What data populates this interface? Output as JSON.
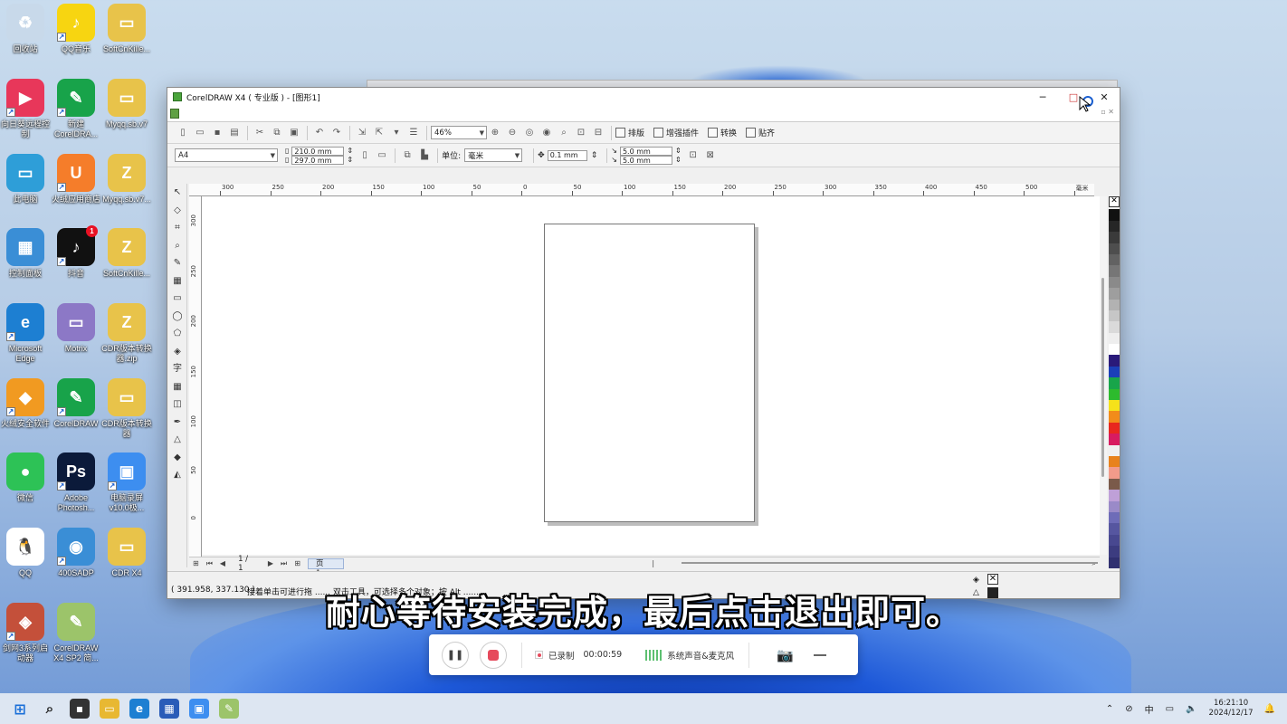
{
  "desktop_icons": [
    {
      "label": "回收站",
      "color": "#c8d9ea",
      "glyph": "♻",
      "link": false,
      "x": 0
    },
    {
      "label": "QQ音乐",
      "color": "#f7d511",
      "glyph": "♪",
      "link": true
    },
    {
      "label": "SoftCnKille...",
      "color": "#e8c34a",
      "glyph": "▭",
      "link": false
    },
    {
      "label": "向日葵远程控制",
      "color": "#e8375a",
      "glyph": "▶",
      "link": true
    },
    {
      "label": "新建 CorelDRA...",
      "color": "#18a34a",
      "glyph": "✎",
      "link": true
    },
    {
      "label": "Myqq.sb.v7",
      "color": "#e8c34a",
      "glyph": "▭",
      "link": false
    },
    {
      "label": "此电脑",
      "color": "#2e9ed8",
      "glyph": "▭",
      "link": false
    },
    {
      "label": "火绒应用商店",
      "color": "#f57d2a",
      "glyph": "U",
      "link": true
    },
    {
      "label": "Myqq.sb.v7...",
      "color": "#e8c34a",
      "glyph": "Z",
      "link": false
    },
    {
      "label": "控制面板",
      "color": "#3a8ed6",
      "glyph": "▦",
      "link": false
    },
    {
      "label": "抖音",
      "color": "#111111",
      "glyph": "♪",
      "link": true,
      "badge": "1"
    },
    {
      "label": "SoftCnKille...",
      "color": "#e8c34a",
      "glyph": "Z",
      "link": false
    },
    {
      "label": "Microsoft Edge",
      "color": "#1d7fd2",
      "glyph": "e",
      "link": true
    },
    {
      "label": "Motrix",
      "color": "#8c78c6",
      "glyph": "▭",
      "link": false
    },
    {
      "label": "CDR版本转换器.zip",
      "color": "#e8c34a",
      "glyph": "Z",
      "link": false
    },
    {
      "label": "火绒安全软件",
      "color": "#f19a21",
      "glyph": "◆",
      "link": true
    },
    {
      "label": "CorelDRAW",
      "color": "#18a34a",
      "glyph": "✎",
      "link": true
    },
    {
      "label": "CDR版本转换器",
      "color": "#e8c34a",
      "glyph": "▭",
      "link": false
    },
    {
      "label": "微信",
      "color": "#2dc256",
      "glyph": "●",
      "link": false
    },
    {
      "label": "Adobe Photosh...",
      "color": "#0b1a3a",
      "glyph": "Ps",
      "link": true
    },
    {
      "label": "电脑录屏 v10.0极...",
      "color": "#3d8ef0",
      "glyph": "▣",
      "link": true
    },
    {
      "label": "QQ",
      "color": "#ffffff",
      "glyph": "🐧",
      "link": false
    },
    {
      "label": "400SADP",
      "color": "#3a8ed6",
      "glyph": "◉",
      "link": true
    },
    {
      "label": "CDR X4",
      "color": "#e8c34a",
      "glyph": "▭",
      "link": false
    },
    {
      "label": "剑网3系列启动器",
      "color": "#c4503a",
      "glyph": "◈",
      "link": true
    },
    {
      "label": "CorelDRAW X4 SP2 简...",
      "color": "#9cc46a",
      "glyph": "✎",
      "link": false
    }
  ],
  "window": {
    "title": "CorelDRAW X4 ( 专业版 ) - [图形1]",
    "minimize": "─",
    "maximize": "□",
    "close": "✕"
  },
  "toolbar": {
    "zoom": "46%",
    "paste_layout": "排版",
    "plugins": "增强插件",
    "convert": "转换",
    "snap": "贴齐"
  },
  "propbar": {
    "page_size": "A4",
    "width": "210.0 mm",
    "height": "297.0 mm",
    "unit_label": "单位:",
    "unit": "毫米",
    "nudge": "0.1 mm",
    "dup_x": "5.0 mm",
    "dup_y": "5.0 mm"
  },
  "ruler": {
    "h_ticks": [
      "300",
      "250",
      "200",
      "150",
      "100",
      "50",
      "0",
      "50",
      "100",
      "150",
      "200",
      "250",
      "300",
      "350",
      "400",
      "450",
      "500",
      "毫米"
    ],
    "v_ticks": [
      "300",
      "250",
      "200",
      "150",
      "100",
      "50",
      "0"
    ]
  },
  "pagebar": {
    "page_count": "1 / 1",
    "page_tab": "页 1"
  },
  "status": {
    "coords": "( 391.958, 337.130 )",
    "hint": "接着单击可进行拖 ...... 双击工具，可选择多个对象；按 Alt ......"
  },
  "subtitle": "耐心等待安装完成，最后点击退出即可。",
  "recorder": {
    "state": "已录制",
    "time": "00:00:59",
    "audio": "系统声音&麦克风"
  },
  "palette": [
    "#111111",
    "#262626",
    "#3a3a3a",
    "#4e4e4e",
    "#626262",
    "#767676",
    "#8a8a8a",
    "#9e9e9e",
    "#b2b2b2",
    "#c6c6c6",
    "#dadada",
    "#eeeeee",
    "#ffffff",
    "#2a1a7a",
    "#1b3fb8",
    "#18a54a",
    "#2dbb2d",
    "#f5e21a",
    "#f28c1a",
    "#e8281e",
    "#d81b60",
    "#f0f0f0",
    "#e8821c",
    "#f29b8a",
    "#7a5a4a",
    "#bfa0d8",
    "#9a8ac8",
    "#6e6cb8",
    "#5656a0",
    "#484890",
    "#3c3c80",
    "#303070"
  ],
  "taskbar": {
    "input_method": "中",
    "time": "16:21:10",
    "date": "2024/12/17"
  }
}
